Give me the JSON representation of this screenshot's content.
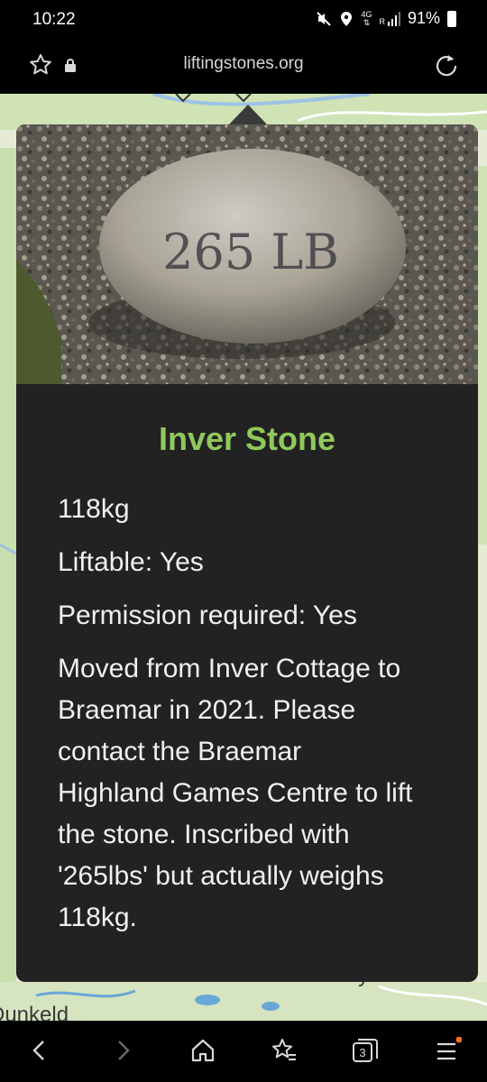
{
  "status_bar": {
    "time": "10:22",
    "network_top": "4G",
    "network_letter": "R",
    "battery": "91%",
    "icons": [
      "mute-icon",
      "location-icon",
      "signal-icon",
      "battery-icon"
    ]
  },
  "browser": {
    "url": "liftingstones.org",
    "icons": [
      "star-icon",
      "lock-icon",
      "reload-icon"
    ]
  },
  "map": {
    "labels": [
      "and Rattray",
      "Dunkeld"
    ]
  },
  "popup": {
    "image_inscription": "265 LB",
    "title": "Inver Stone",
    "weight": "118kg",
    "liftable": "Liftable: Yes",
    "permission": "Permission required: Yes",
    "description_lines": [
      "Moved from Inver Cottage to",
      "Braemar in 2021. Please",
      "contact the Braemar",
      "Highland Games Centre to lift",
      "the stone. Inscribed with",
      "'265lbs' but actually weighs",
      "118kg."
    ],
    "title_color": "#8fc95a"
  },
  "bottom_nav": {
    "tab_count": "3",
    "icons": [
      "back-icon",
      "forward-icon",
      "home-icon",
      "bookmarks-icon",
      "tabs-icon",
      "menu-icon"
    ]
  }
}
